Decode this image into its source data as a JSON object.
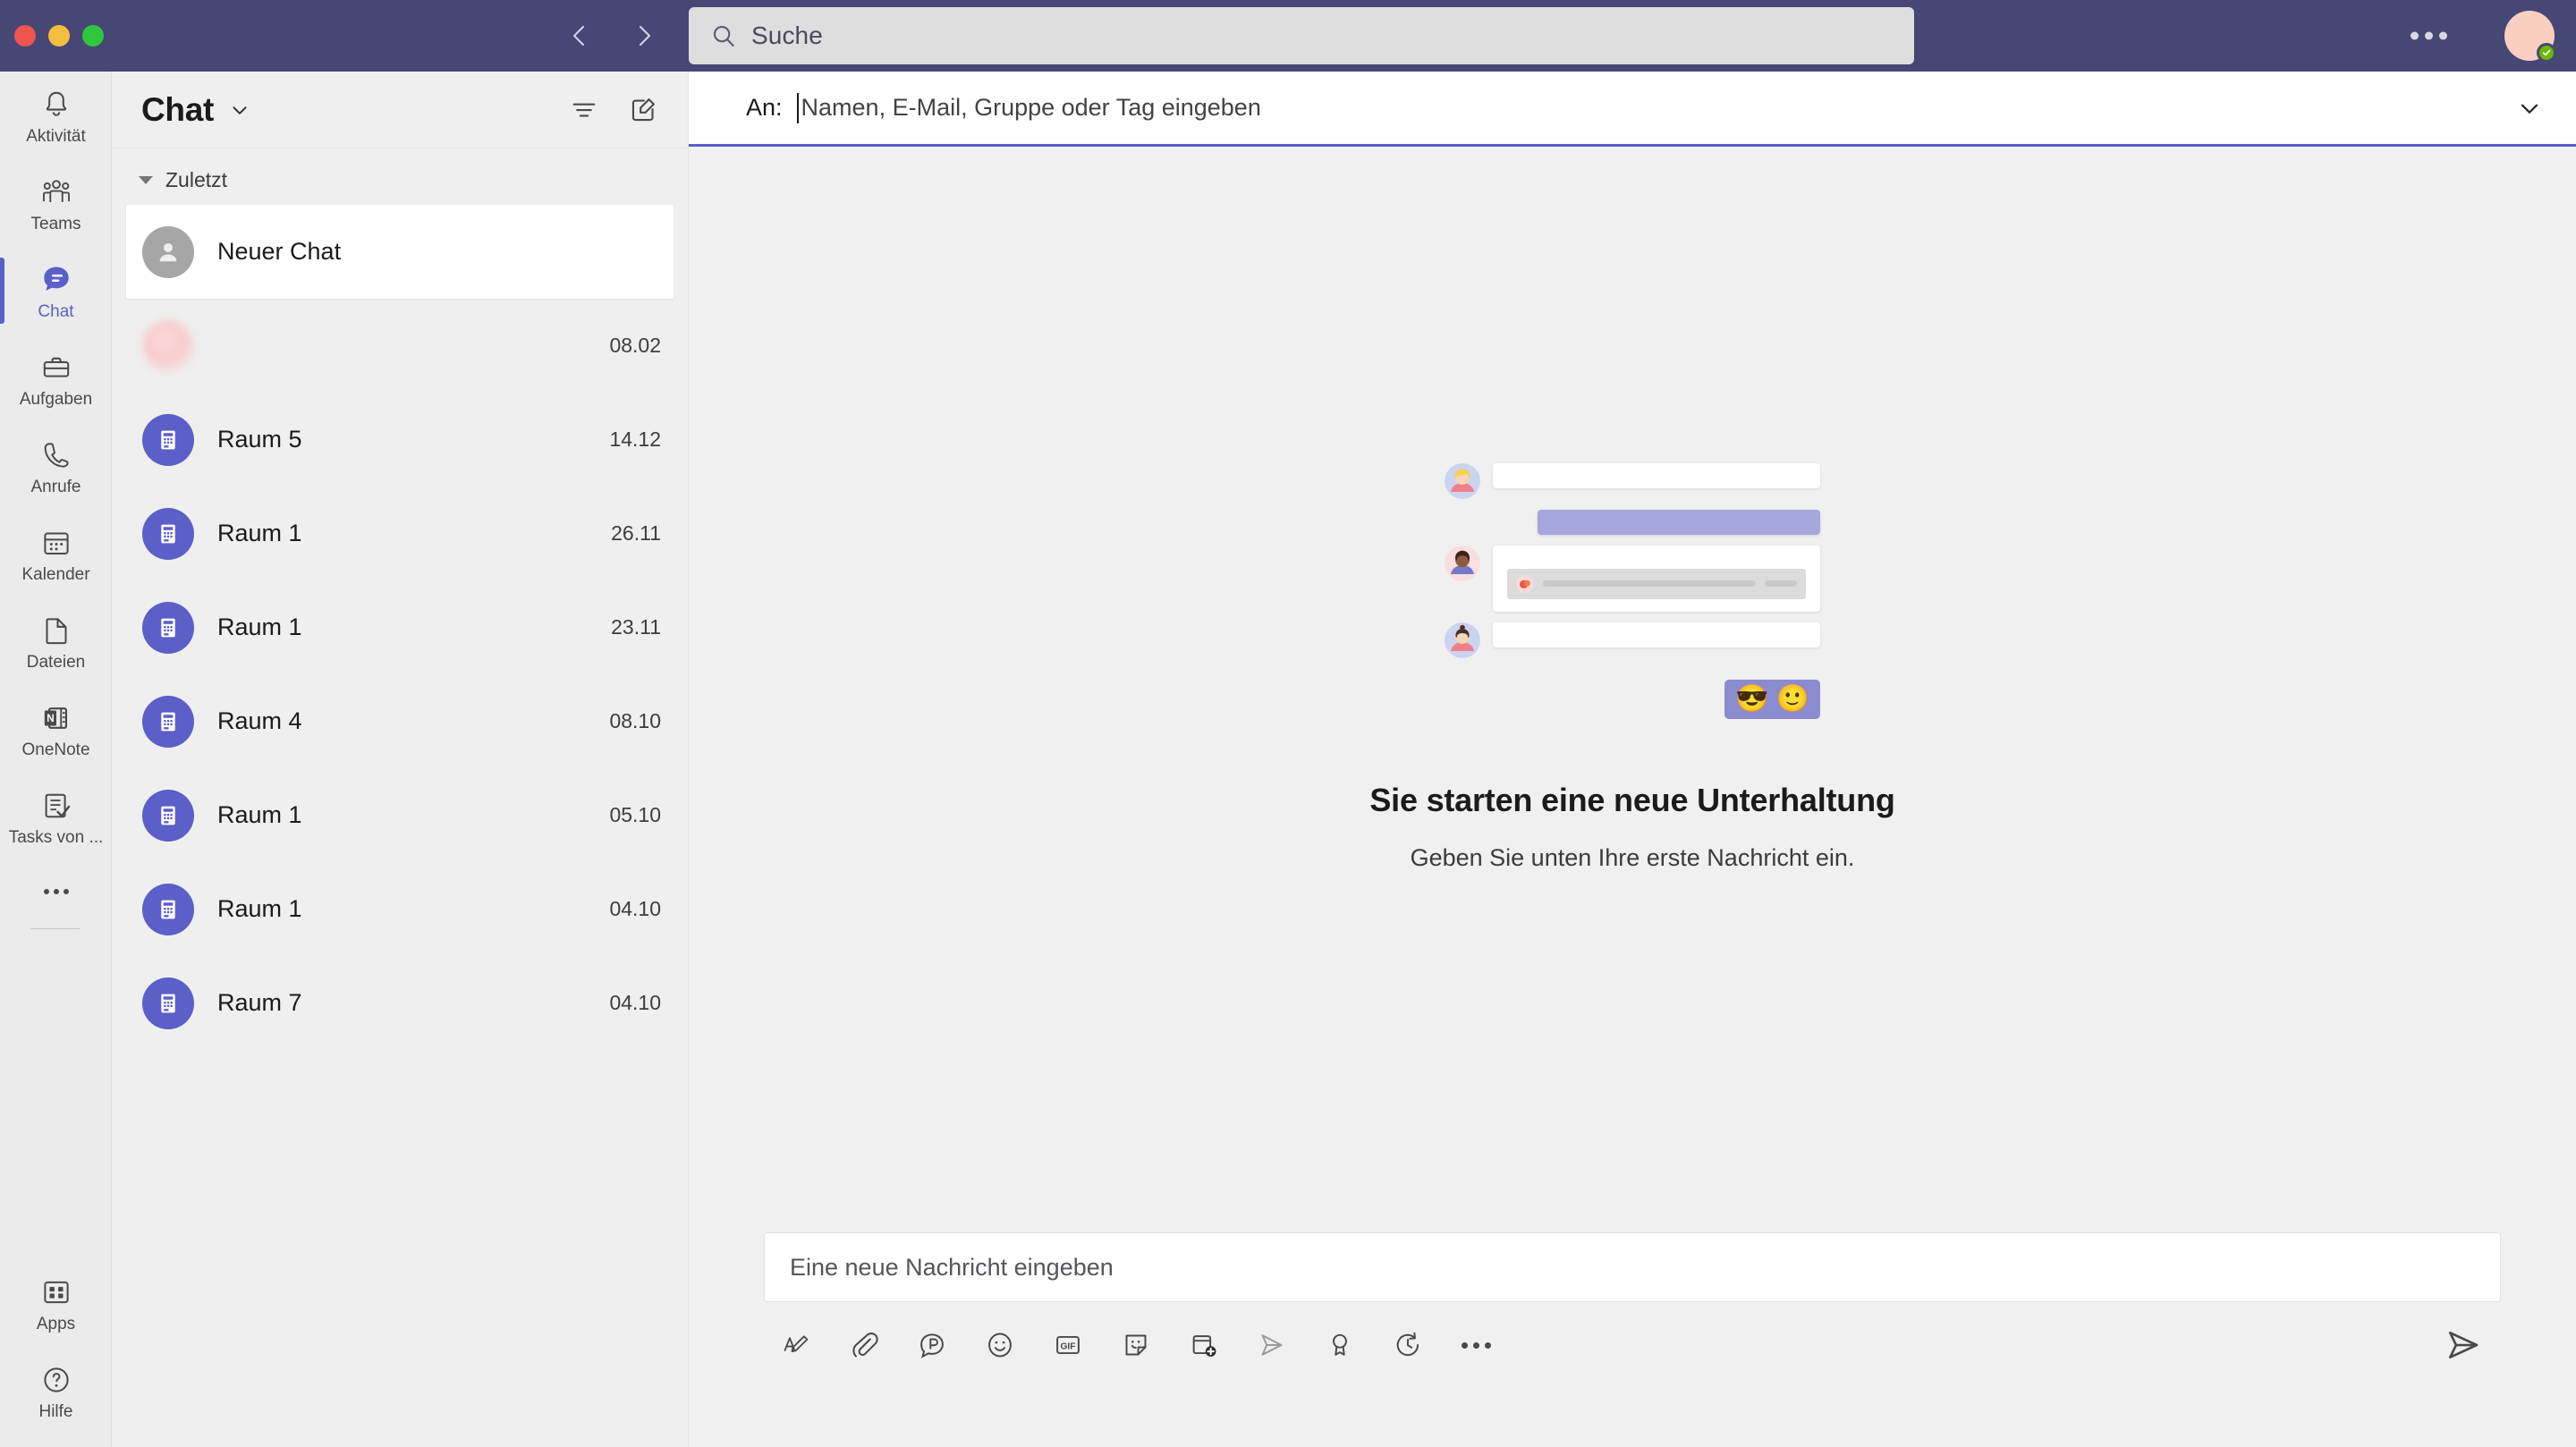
{
  "titlebar": {
    "window_controls": [
      "close",
      "minimize",
      "maximize"
    ],
    "nav": {
      "back_label": "Zurück",
      "forward_label": "Vorwärts"
    },
    "search": {
      "placeholder": "Suche",
      "value": ""
    },
    "more_label": "Weitere Optionen",
    "avatar_presence": "Verfügbar"
  },
  "rail": {
    "items": [
      {
        "label": "Aktivität",
        "icon": "bell-icon",
        "active": false
      },
      {
        "label": "Teams",
        "icon": "people-icon",
        "active": false
      },
      {
        "label": "Chat",
        "icon": "chat-icon",
        "active": true
      },
      {
        "label": "Aufgaben",
        "icon": "briefcase-icon",
        "active": false
      },
      {
        "label": "Anrufe",
        "icon": "phone-icon",
        "active": false
      },
      {
        "label": "Kalender",
        "icon": "calendar-icon",
        "active": false
      },
      {
        "label": "Dateien",
        "icon": "file-icon",
        "active": false
      },
      {
        "label": "OneNote",
        "icon": "onenote-icon",
        "active": false
      },
      {
        "label": "Tasks von ...",
        "icon": "tasks-icon",
        "active": false
      }
    ],
    "more_label": "Mehr Apps",
    "bottom": [
      {
        "label": "Apps",
        "icon": "apps-icon"
      },
      {
        "label": "Hilfe",
        "icon": "help-icon"
      }
    ]
  },
  "chatlist": {
    "title": "Chat",
    "caret_label": "Chatfilter auswählen",
    "filter_label": "Filter",
    "compose_label": "Neuer Chat",
    "section": {
      "label": "Zuletzt",
      "expanded": true
    },
    "rows": [
      {
        "name": "Neuer Chat",
        "date": "",
        "avatar": "person",
        "selected": true
      },
      {
        "name": "",
        "date": "08.02",
        "avatar": "blur",
        "selected": false,
        "badge": "blocked-icon"
      },
      {
        "name": "Raum 5",
        "date": "14.12",
        "avatar": "team",
        "selected": false
      },
      {
        "name": "Raum 1",
        "date": "26.11",
        "avatar": "team",
        "selected": false
      },
      {
        "name": "Raum 1",
        "date": "23.11",
        "avatar": "team",
        "selected": false
      },
      {
        "name": "Raum 4",
        "date": "08.10",
        "avatar": "team",
        "selected": false
      },
      {
        "name": "Raum 1",
        "date": "05.10",
        "avatar": "team",
        "selected": false
      },
      {
        "name": "Raum 1",
        "date": "04.10",
        "avatar": "team",
        "selected": false
      },
      {
        "name": "Raum 7",
        "date": "04.10",
        "avatar": "team",
        "selected": false
      }
    ]
  },
  "main": {
    "to": {
      "label": "An:",
      "placeholder": "Namen, E-Mail, Gruppe oder Tag eingeben",
      "value": "",
      "expand_label": "Erweitern"
    },
    "empty_state": {
      "heading": "Sie starten eine neue Unterhaltung",
      "subtext": "Geben Sie unten Ihre erste Nachricht ein.",
      "illustration": {
        "reactions": [
          "😎",
          "🙂"
        ]
      }
    },
    "composer": {
      "placeholder": "Eine neue Nachricht eingeben",
      "value": "",
      "tools": [
        {
          "name": "format-icon",
          "label": "Format"
        },
        {
          "name": "attach-icon",
          "label": "Anfügen"
        },
        {
          "name": "loop-icon",
          "label": "Loop-Komponente"
        },
        {
          "name": "emoji-icon",
          "label": "Emoji"
        },
        {
          "name": "gif-icon",
          "label": "GIF"
        },
        {
          "name": "sticker-icon",
          "label": "Sticker"
        },
        {
          "name": "meet-now-icon",
          "label": "Jetzt besprechen"
        },
        {
          "name": "stream-icon",
          "label": "Stream"
        },
        {
          "name": "praise-icon",
          "label": "Lob"
        },
        {
          "name": "schedule-send-icon",
          "label": "Senden planen"
        },
        {
          "name": "more-icon",
          "label": "Weitere Optionen"
        }
      ],
      "send_label": "Senden"
    }
  },
  "colors": {
    "brand_purple": "#464775",
    "accent": "#5b5fc7",
    "rail_bg": "#ebebeb",
    "list_bg": "#efefef",
    "main_bg": "#f0f0f0",
    "presence_green": "#6bb700",
    "avatar_peach": "#f9cfc0"
  }
}
